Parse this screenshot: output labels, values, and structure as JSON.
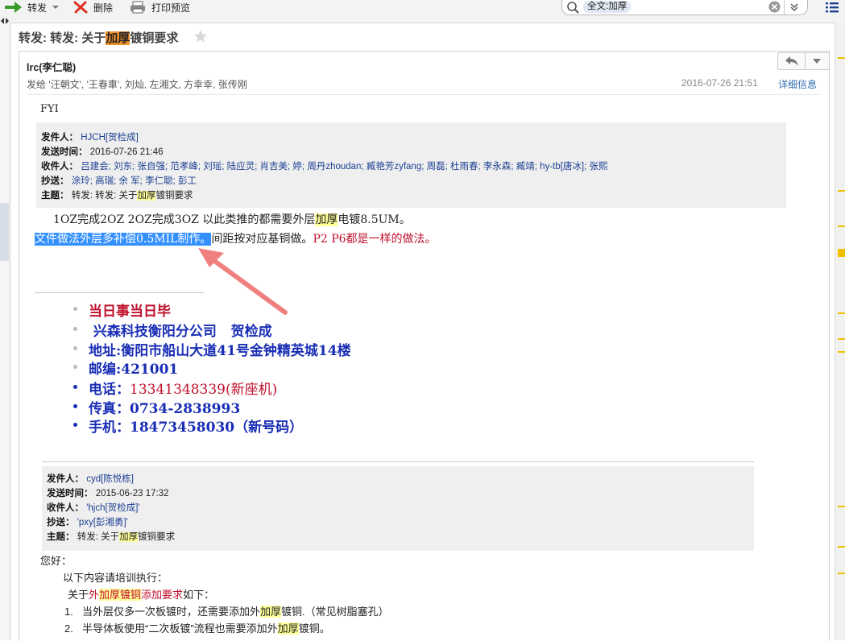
{
  "toolbar": {
    "forward_label": "转发",
    "delete_label": "删除",
    "print_preview_label": "打印预览",
    "search_tag": "全文:加厚"
  },
  "email": {
    "subject_prefix": "转发: 转发: 关于",
    "subject_highlight": "加厚",
    "subject_suffix": "镀铜要求",
    "sender": "lrc(李仁聪)",
    "recipients": "发给 '汪朝文', '王春車', 刘灿, 左湘文, 方幸幸, 张传刚",
    "datetime": "2016-07-26 21:51",
    "details_link": "详细信息"
  },
  "body": {
    "fyi": "FYI",
    "quote1": {
      "from_label": "发件人：",
      "from_value": "HJCH[贺检成]",
      "sent_label": "发送时间：",
      "sent_value": "2016-07-26 21:46",
      "to_label": "收件人：",
      "to_value": "吕建会; 刘东; 张自强; 范孝峰; 刘瑶; 陆应灵; 肖吉美; 婷; 周丹zhoudan; 臧艳芳zyfang; 周磊; 杜雨春; 李永森; 臧靖; hy-tb[唐冰]; 张熙",
      "cc_label": "抄送：",
      "cc_value": "涂玲; 高瑞; 余 军; 李仁聪; 彭工",
      "subj_label": "主题：",
      "subj_prefix": "转发: 转发: 关于",
      "subj_highlight": "加厚",
      "subj_suffix": "镀铜要求"
    },
    "line1_prefix": "1OZ完成2OZ  2OZ完成3OZ  以此类推的都需要外层",
    "line1_highlight": "加厚",
    "line1_suffix": "电镀8.5UM。",
    "line2_selected": "文件做法外层多补偿0.5MIL制作。",
    "line2_middle": "间距按对应基铜做。",
    "line2_red": "P2 P6都是一样的做法。",
    "signature": [
      "当日事当日毕",
      " 兴森科技衡阳分公司   贺检成",
      "地址:衡阳市船山大道41号金钟精英城14楼",
      "邮编:421001",
      "电话：",
      "传真：0734-2838993",
      "手机：18473458030（新号码）"
    ],
    "phone_red": "13341348339(新座机)",
    "quote2": {
      "from_label": "发件人：",
      "from_value": "cyd[陈悦栋]",
      "sent_label": "发送时间：",
      "sent_value": "2015-06-23 17:32",
      "to_label": "收件人：",
      "to_value": "'hjch[贺检成]'",
      "cc_label": "抄送：",
      "cc_value": "'pxy[彭湘勇]'",
      "subj_label": "主题：",
      "subj_prefix": "转发: 关于",
      "subj_highlight": "加厚",
      "subj_suffix": "镀铜要求"
    },
    "greeting": "您好：",
    "instruction": "以下内容请培训执行：",
    "about_prefix": "关于",
    "about_red1": "外",
    "about_hl": "加厚镀铜",
    "about_red2": "添加要求",
    "about_suffix": "如下：",
    "items": [
      {
        "num": "1.",
        "prefix": "当外层仅多一次板镀时，还需要添加外",
        "hl": "加厚",
        "suffix": "镀铜.（常见树脂塞孔）"
      },
      {
        "num": "2.",
        "prefix": "半导体板使用“二次板镀”流程也需要添加外",
        "hl": "加厚",
        "suffix": "镀铜。"
      }
    ]
  },
  "colors": {
    "accent": "#2f6cb3",
    "highlight": "#ffff99",
    "subject_highlight": "#f0932b",
    "signature_blue": "#1a2eb5",
    "signature_red": "#c0102b",
    "arrow": "#f08080"
  }
}
